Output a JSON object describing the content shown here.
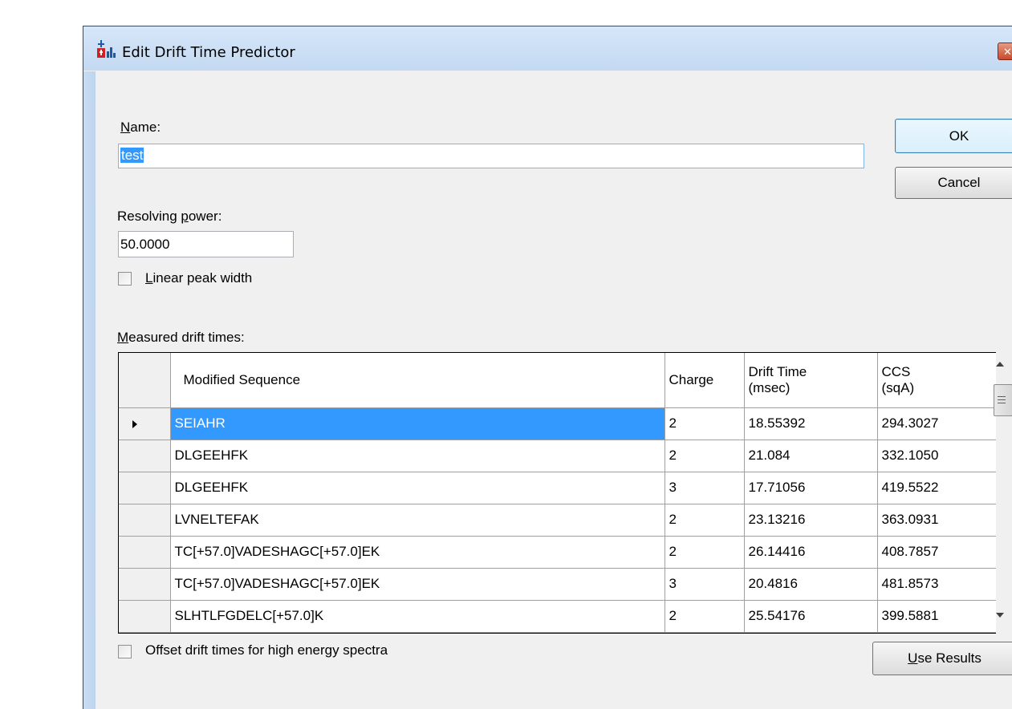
{
  "window": {
    "title": "Edit Drift Time Predictor",
    "close_glyph": "✕"
  },
  "name": {
    "label_prefix": "",
    "label_accel": "N",
    "label_rest": "ame:",
    "value": "test"
  },
  "resolving_power": {
    "label_prefix": "Resolving ",
    "label_accel": "p",
    "label_rest": "ower:",
    "value": "50.0000"
  },
  "linear_peak_width": {
    "label_accel": "L",
    "label_rest": "inear peak width",
    "checked": false
  },
  "measured": {
    "label_accel": "M",
    "label_rest": "easured drift times:"
  },
  "table": {
    "headers": {
      "sequence": "Modified Sequence",
      "charge": "Charge",
      "drift_line1": "Drift Time",
      "drift_line2": "(msec)",
      "ccs_line1": "CCS",
      "ccs_line2": "(sqA)"
    },
    "rows": [
      {
        "sequence": "SEIAHR",
        "charge": "2",
        "drift": "18.55392",
        "ccs": "294.3027"
      },
      {
        "sequence": "DLGEEHFK",
        "charge": "2",
        "drift": "21.084",
        "ccs": "332.1050"
      },
      {
        "sequence": "DLGEEHFK",
        "charge": "3",
        "drift": "17.71056",
        "ccs": "419.5522"
      },
      {
        "sequence": "LVNELTEFAK",
        "charge": "2",
        "drift": "23.13216",
        "ccs": "363.0931"
      },
      {
        "sequence": "TC[+57.0]VADESHAGC[+57.0]EK",
        "charge": "2",
        "drift": "26.14416",
        "ccs": "408.7857"
      },
      {
        "sequence": "TC[+57.0]VADESHAGC[+57.0]EK",
        "charge": "3",
        "drift": "20.4816",
        "ccs": "481.8573"
      },
      {
        "sequence": "SLHTLFGDELC[+57.0]K",
        "charge": "2",
        "drift": "25.54176",
        "ccs": "399.5881"
      }
    ]
  },
  "offset_checkbox": {
    "label": "Offset drift times for high energy spectra",
    "checked": false
  },
  "buttons": {
    "ok": "OK",
    "cancel": "Cancel",
    "use_results_accel": "U",
    "use_results_rest": "se Results"
  }
}
